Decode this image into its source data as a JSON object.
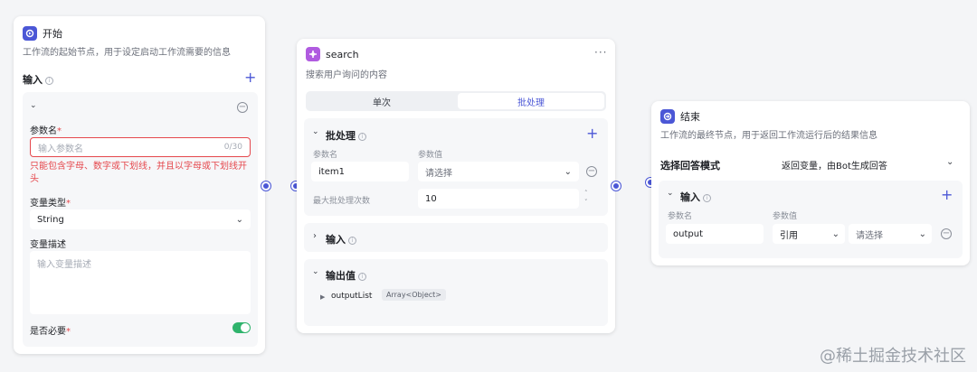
{
  "start_node": {
    "title": "开始",
    "description": "工作流的起始节点，用于设定启动工作流需要的信息",
    "input_label": "输入",
    "param_name_label": "参数名",
    "param_name_placeholder": "输入参数名",
    "param_name_counter": "0/30",
    "param_error": "只能包含字母、数字或下划线，并且以字母或下划线开头",
    "var_type_label": "变量类型",
    "var_type_value": "String",
    "var_desc_label": "变量描述",
    "var_desc_placeholder": "输入变量描述",
    "required_label": "是否必要",
    "required_on": true
  },
  "search_node": {
    "title": "search",
    "description": "搜索用户询问的内容",
    "tabs": [
      "单次",
      "批处理"
    ],
    "active_tab": 1,
    "batch_label": "批处理",
    "col_param_name": "参数名",
    "col_param_value": "参数值",
    "item_name": "item1",
    "item_select_placeholder": "请选择",
    "max_batch_label": "最大批处理次数",
    "max_batch_value": "10",
    "input_label": "输入",
    "output_label": "输出值",
    "output_name": "outputList",
    "output_type": "Array<Object>"
  },
  "end_node": {
    "title": "结束",
    "description": "工作流的最终节点，用于返回工作流运行后的结果信息",
    "answer_mode_label": "选择回答模式",
    "answer_mode_value": "返回变量，由Bot生成回答",
    "input_label": "输入",
    "col_param_name": "参数名",
    "col_param_value": "参数值",
    "output_name": "output",
    "ref_value": "引用",
    "select_placeholder": "请选择"
  },
  "watermark": "@稀土掘金技术社区",
  "colors": {
    "accent": "#4b57d6",
    "error": "#e5484d",
    "toggle": "#2fb36c"
  }
}
